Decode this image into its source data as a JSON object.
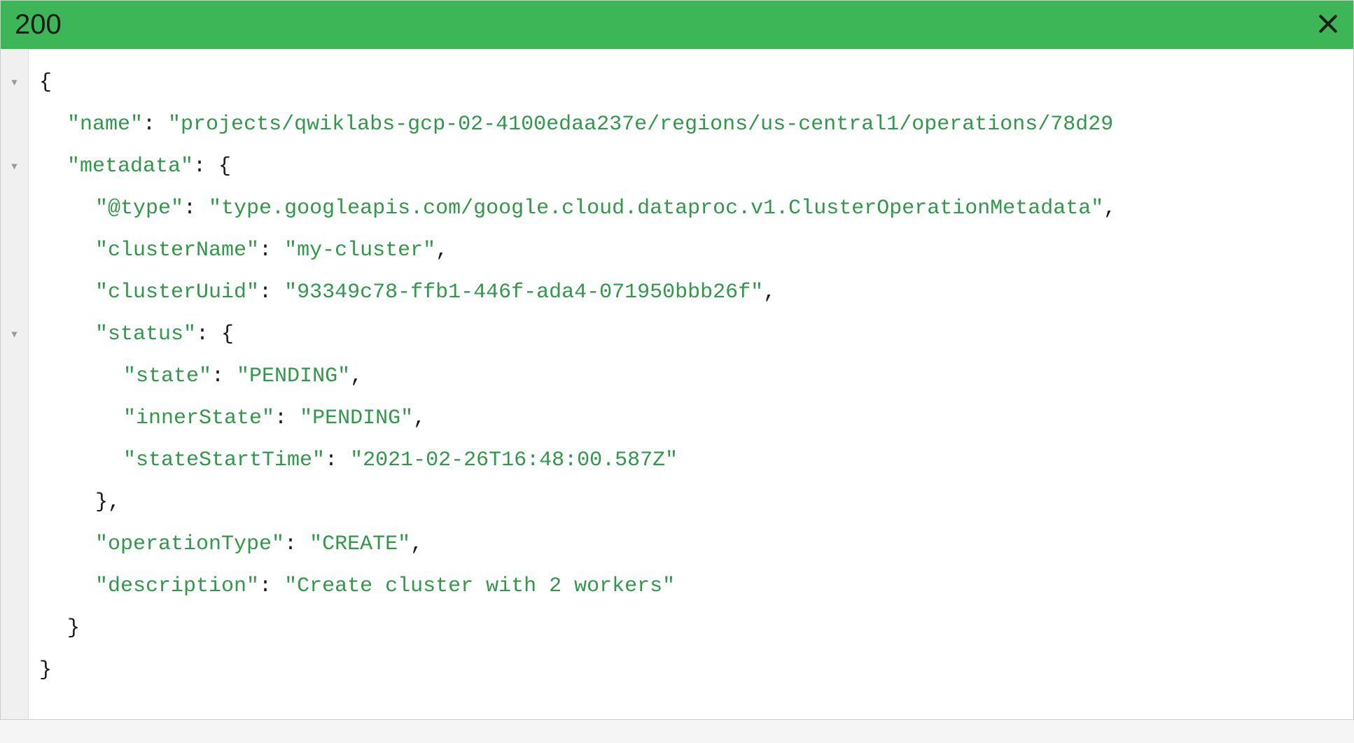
{
  "header": {
    "status_code": "200"
  },
  "gutter": {
    "fold_marker": "▼"
  },
  "response": {
    "open_brace": "{",
    "close_brace": "}",
    "colon_space": ": ",
    "comma": ",",
    "name_key": "\"name\"",
    "name_value": "\"projects/qwiklabs-gcp-02-4100edaa237e/regions/us-central1/operations/78d29",
    "metadata_key": "\"metadata\"",
    "metadata_open": "{",
    "type_key": "\"@type\"",
    "type_value": "\"type.googleapis.com/google.cloud.dataproc.v1.ClusterOperationMetadata\"",
    "clusterName_key": "\"clusterName\"",
    "clusterName_value": "\"my-cluster\"",
    "clusterUuid_key": "\"clusterUuid\"",
    "clusterUuid_value": "\"93349c78-ffb1-446f-ada4-071950bbb26f\"",
    "status_key": "\"status\"",
    "status_open": "{",
    "state_key": "\"state\"",
    "state_value": "\"PENDING\"",
    "innerState_key": "\"innerState\"",
    "innerState_value": "\"PENDING\"",
    "stateStartTime_key": "\"stateStartTime\"",
    "stateStartTime_value": "\"2021-02-26T16:48:00.587Z\"",
    "status_close": "}",
    "operationType_key": "\"operationType\"",
    "operationType_value": "\"CREATE\"",
    "description_key": "\"description\"",
    "description_value": "\"Create cluster with 2 workers\"",
    "metadata_close": "}"
  }
}
